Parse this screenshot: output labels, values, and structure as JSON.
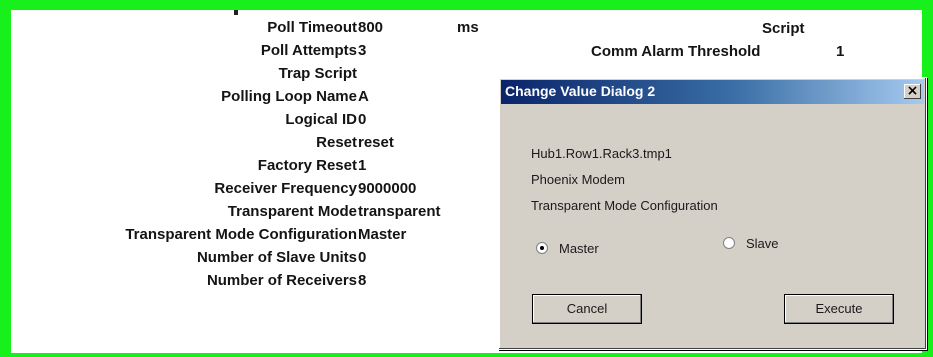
{
  "properties": [
    {
      "label": "Poll Timeout",
      "value": "800",
      "unit": "ms"
    },
    {
      "label": "Poll Attempts",
      "value": "3"
    },
    {
      "label": "Trap Script",
      "value": ""
    },
    {
      "label": "Polling Loop Name",
      "value": "A"
    },
    {
      "label": "Logical ID",
      "value": "0"
    },
    {
      "label": "Reset",
      "value": "reset"
    },
    {
      "label": "Factory Reset",
      "value": "1"
    },
    {
      "label": "Receiver Frequency",
      "value": "9000000"
    },
    {
      "label": "Transparent Mode",
      "value": "transparent"
    },
    {
      "label": "Transparent Mode Configuration",
      "value": "Master"
    },
    {
      "label": "Number of Slave Units",
      "value": "0"
    },
    {
      "label": "Number of Receivers",
      "value": "8"
    }
  ],
  "right_panel": {
    "script_label": "Script",
    "comm_alarm_label": "Comm Alarm Threshold",
    "comm_alarm_value": "1"
  },
  "dialog": {
    "title": "Change Value Dialog 2",
    "close_glyph": "×",
    "device_path": "Hub1.Row1.Rack3.tmp1",
    "device_type": "Phoenix Modem",
    "parameter": "Transparent Mode Configuration",
    "options": [
      {
        "label": "Master",
        "selected": true
      },
      {
        "label": "Slave",
        "selected": false
      }
    ],
    "cancel_label": "Cancel",
    "execute_label": "Execute"
  },
  "colors": {
    "frame": "#17f01a",
    "titlebar_start": "#0a246a",
    "titlebar_end": "#a6caf0",
    "dialog_bg": "#d4d0c8"
  }
}
